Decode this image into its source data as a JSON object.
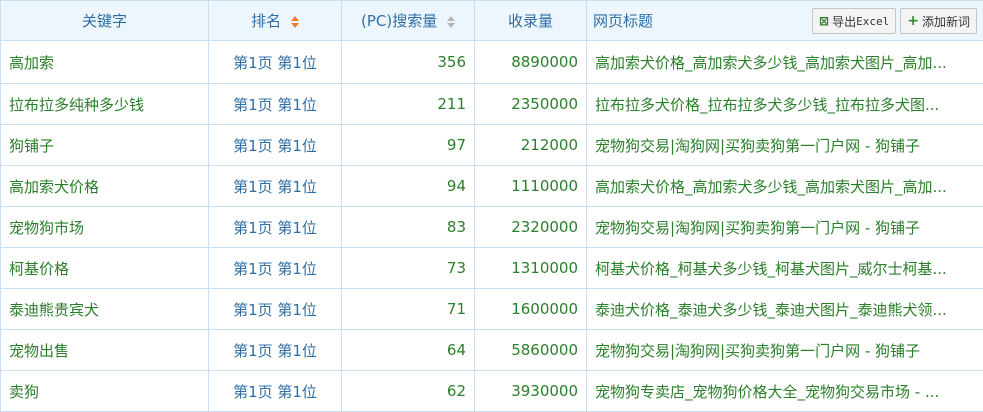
{
  "header": {
    "keyword": "关键字",
    "rank": "排名",
    "pc_volume": "(PC)搜索量",
    "indexed": "收录量",
    "page_title": "网页标题",
    "export_btn": {
      "prefix": "导出",
      "label": "Excel"
    },
    "add_btn": "添加新词"
  },
  "rows": [
    {
      "keyword": "高加索",
      "rank": "第1页 第1位",
      "volume": "356",
      "indexed": "8890000",
      "title": "高加索犬价格_高加索犬多少钱_高加索犬图片_高加..."
    },
    {
      "keyword": "拉布拉多纯种多少钱",
      "rank": "第1页 第1位",
      "volume": "211",
      "indexed": "2350000",
      "title": "拉布拉多犬价格_拉布拉多犬多少钱_拉布拉多犬图..."
    },
    {
      "keyword": "狗铺子",
      "rank": "第1页 第1位",
      "volume": "97",
      "indexed": "212000",
      "title": "宠物狗交易|淘狗网|买狗卖狗第一门户网 - 狗铺子"
    },
    {
      "keyword": "高加索犬价格",
      "rank": "第1页 第1位",
      "volume": "94",
      "indexed": "1110000",
      "title": "高加索犬价格_高加索犬多少钱_高加索犬图片_高加..."
    },
    {
      "keyword": "宠物狗市场",
      "rank": "第1页 第1位",
      "volume": "83",
      "indexed": "2320000",
      "title": "宠物狗交易|淘狗网|买狗卖狗第一门户网 - 狗铺子"
    },
    {
      "keyword": "柯基价格",
      "rank": "第1页 第1位",
      "volume": "73",
      "indexed": "1310000",
      "title": "柯基犬价格_柯基犬多少钱_柯基犬图片_威尔士柯基..."
    },
    {
      "keyword": "泰迪熊贵宾犬",
      "rank": "第1页 第1位",
      "volume": "71",
      "indexed": "1600000",
      "title": "泰迪犬价格_泰迪犬多少钱_泰迪犬图片_泰迪熊犬领..."
    },
    {
      "keyword": "宠物出售",
      "rank": "第1页 第1位",
      "volume": "64",
      "indexed": "5860000",
      "title": "宠物狗交易|淘狗网|买狗卖狗第一门户网 - 狗铺子"
    },
    {
      "keyword": "卖狗",
      "rank": "第1页 第1位",
      "volume": "62",
      "indexed": "3930000",
      "title": "宠物狗专卖店_宠物狗价格大全_宠物狗交易市场 - ..."
    }
  ]
}
